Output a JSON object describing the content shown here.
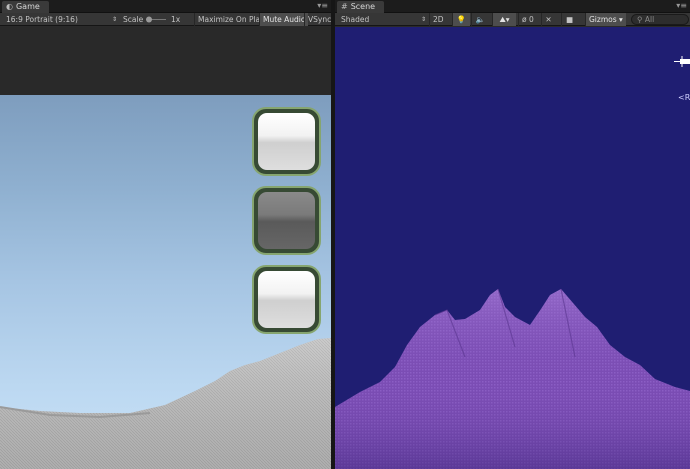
{
  "game": {
    "tab_title": "Game",
    "aspect": "16:9 Portrait (9:16)",
    "scale_label": "Scale",
    "scale_value": "1x",
    "maximize_on_play": "Maximize On Play",
    "mute_audio": "Mute Audio",
    "vsync": "VSync",
    "ui_buttons": [
      {
        "style": "light"
      },
      {
        "style": "dark"
      },
      {
        "style": "light"
      }
    ]
  },
  "scene": {
    "tab_title": "Scene",
    "draw_mode": "Shaded",
    "mode_2d": "2D",
    "hidden_count": "0",
    "gizmos": "Gizmos",
    "search_placeholder": "All",
    "overlay_text": "<R"
  },
  "colors": {
    "scene_background": "#1f1e72",
    "terrain_purple": "#7a4cb3",
    "button_border": "#86a56f"
  }
}
